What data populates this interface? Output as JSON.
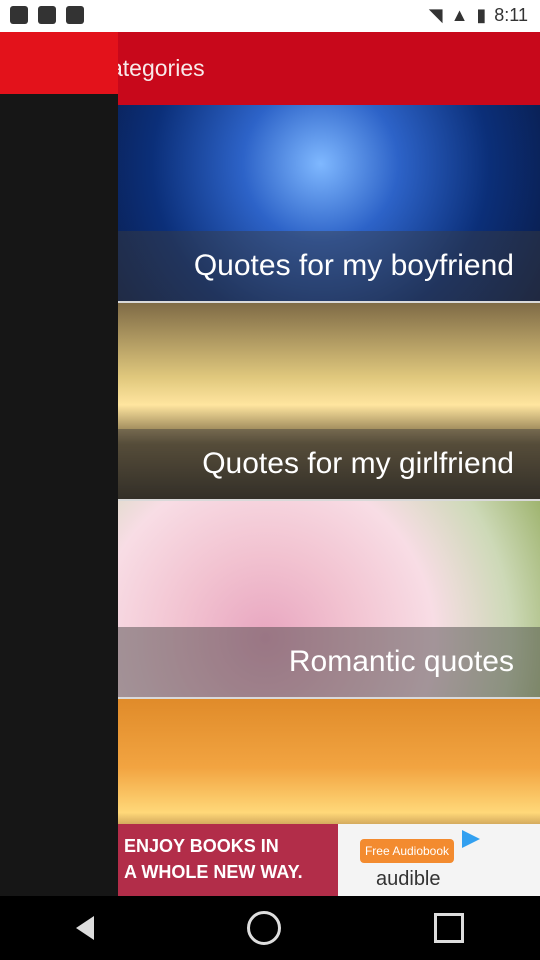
{
  "status_bar": {
    "time": "8:11"
  },
  "toolbar": {
    "title": "ategories"
  },
  "categories": [
    {
      "label": "Quotes for my boyfriend"
    },
    {
      "label": "Quotes for my girlfriend"
    },
    {
      "label": "Romantic quotes"
    },
    {
      "label": ""
    }
  ],
  "ad": {
    "title_line1": "ENJOY BOOKS IN",
    "title_line2": "A WHOLE NEW WAY.",
    "cta": "Free Audiobook",
    "brand": "audible"
  }
}
